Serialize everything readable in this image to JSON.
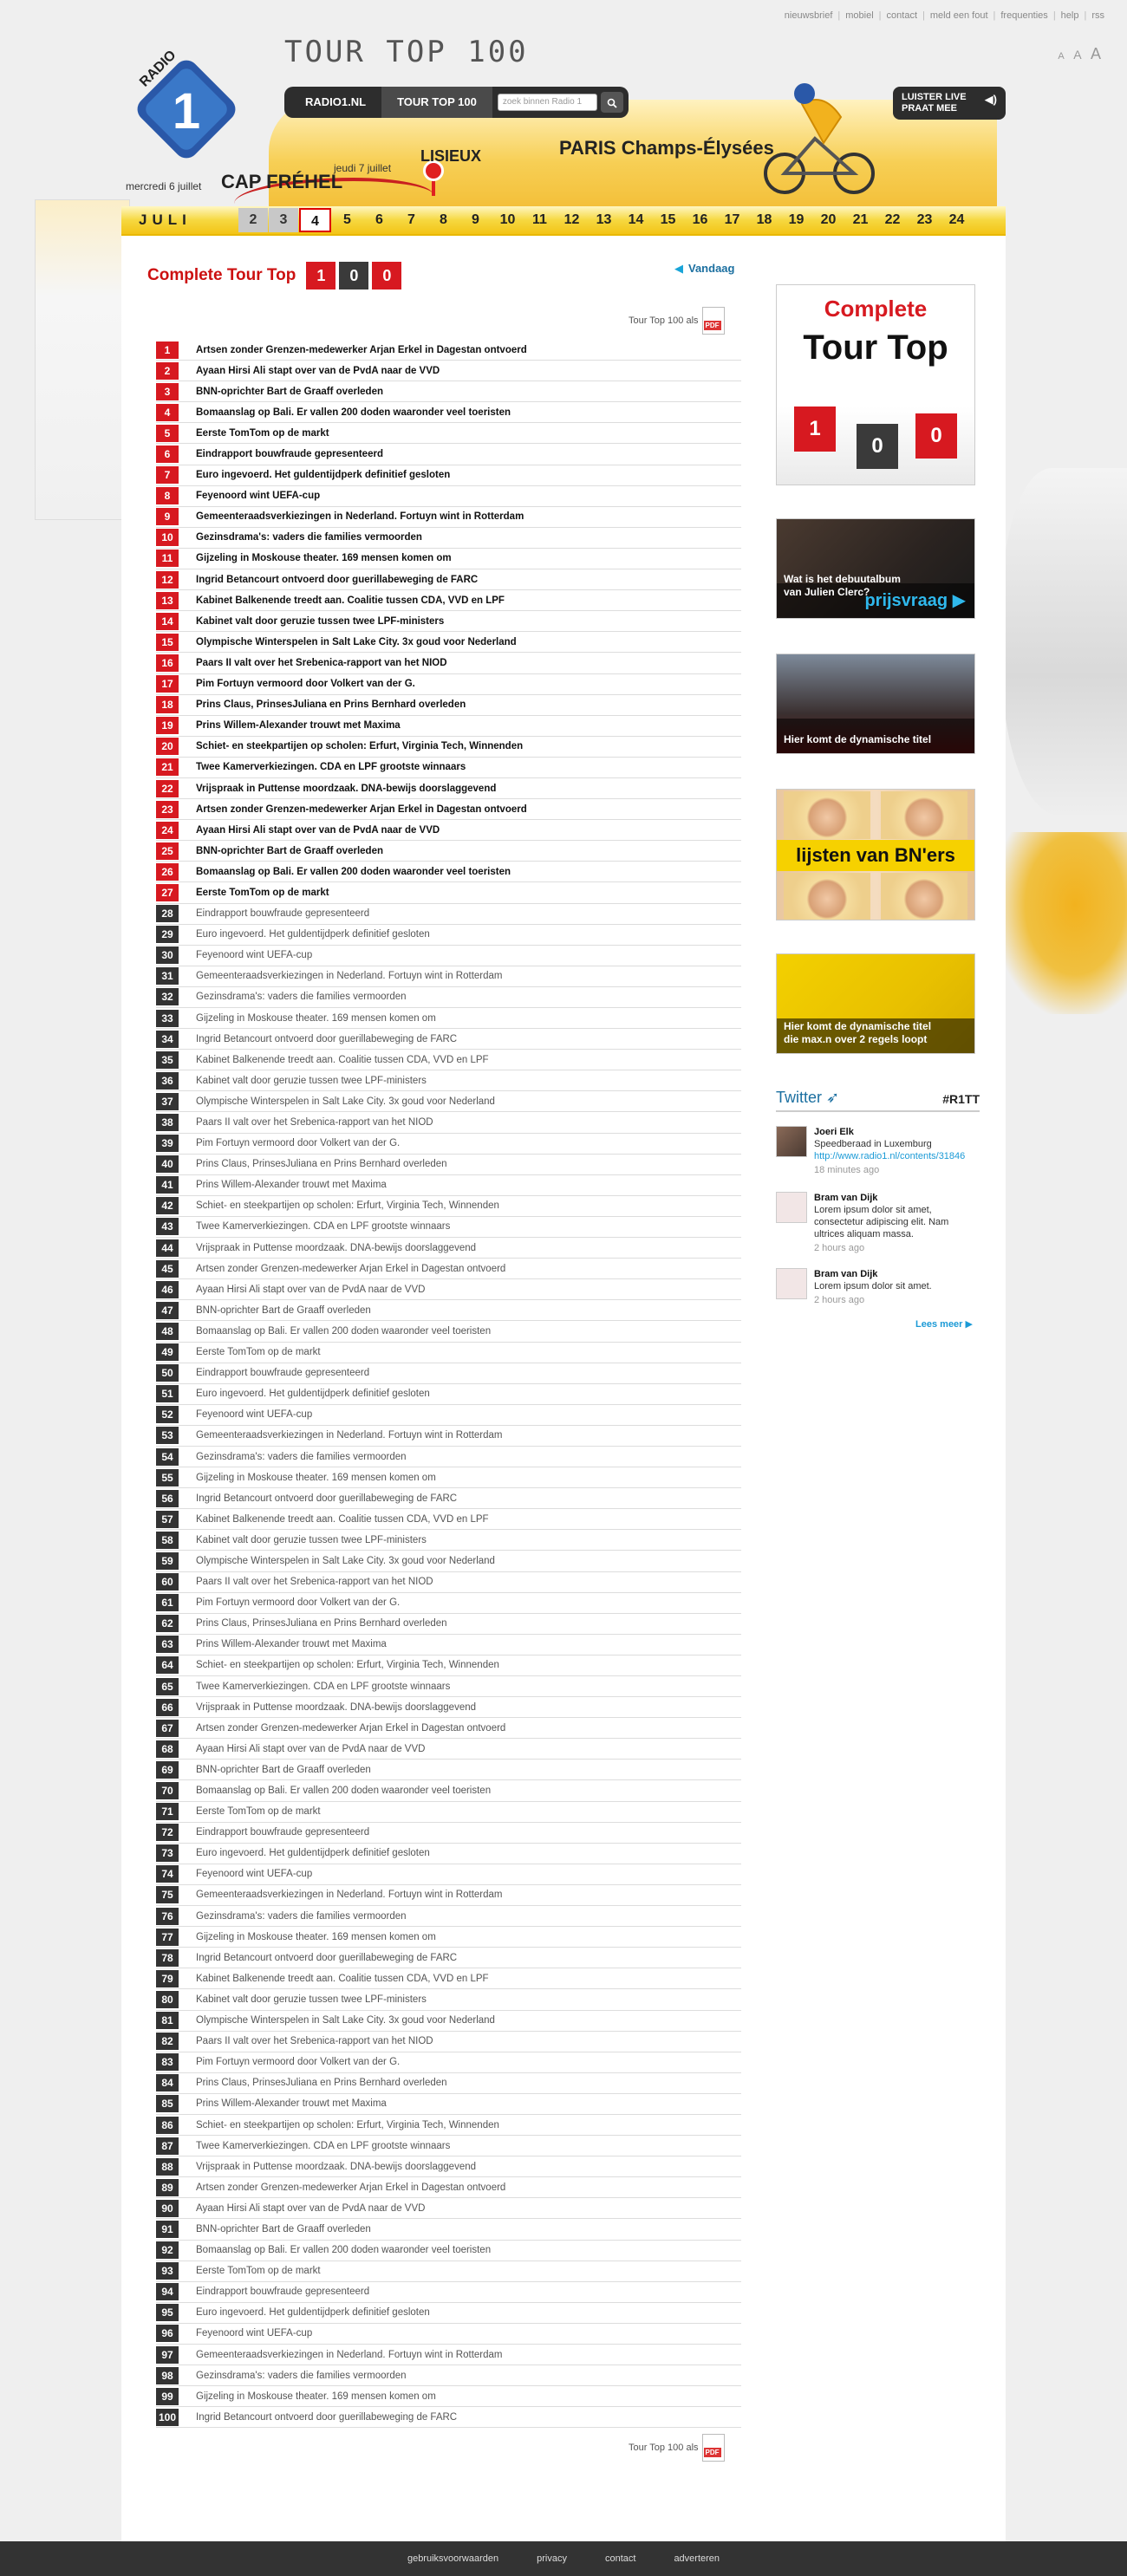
{
  "top_links": [
    "nieuwsbrief",
    "mobiel",
    "contact",
    "meld een fout",
    "frequenties",
    "help",
    "rss"
  ],
  "font_size_controls": [
    "A",
    "A",
    "A"
  ],
  "header": {
    "title": "TOUR TOP 100",
    "nav": [
      {
        "label": "RADIO1.NL",
        "active": false
      },
      {
        "label": "TOUR TOP 100",
        "active": true
      }
    ],
    "search_placeholder": "zoek binnen Radio 1",
    "search_icon": "magnifier-icon",
    "luister_line1": "LUISTER LIVE",
    "luister_line2": "PRAAT MEE",
    "stages": {
      "cap": "CAP FRÉHEL",
      "merc": "mercredi 6 juillet",
      "jeudi": "jeudi 7 juillet",
      "lisieux": "LISIEUX",
      "paris": "PARIS Champs-Élysées"
    },
    "logo_text": "RADIO"
  },
  "datebar": {
    "month": "JULI",
    "days": [
      "2",
      "3",
      "4",
      "5",
      "6",
      "7",
      "8",
      "9",
      "10",
      "11",
      "12",
      "13",
      "14",
      "15",
      "16",
      "17",
      "18",
      "19",
      "20",
      "21",
      "22",
      "23",
      "24"
    ],
    "today": "4",
    "past": [
      "2",
      "3"
    ]
  },
  "main": {
    "title": "Complete Tour Top",
    "title_boxes": [
      "1",
      "0",
      "0"
    ],
    "vandaag": "Vandaag",
    "pdf_label": "Tour Top 100 als",
    "rows": [
      "Artsen zonder Grenzen-medewerker Arjan Erkel in Dagestan ontvoerd",
      "Ayaan Hirsi Ali stapt over van de PvdA naar de VVD",
      "BNN-oprichter Bart de Graaff overleden",
      "Bomaanslag op Bali. Er vallen 200 doden waaronder veel toeristen",
      "Eerste TomTom op de markt",
      "Eindrapport bouwfraude gepresenteerd",
      "Euro ingevoerd. Het guldentijdperk definitief gesloten",
      "Feyenoord wint UEFA-cup",
      "Gemeenteraadsverkiezingen in Nederland. Fortuyn wint in Rotterdam",
      "Gezinsdrama's: vaders die families vermoorden",
      "Gijzeling in Moskouse theater. 169 mensen komen om",
      "Ingrid Betancourt ontvoerd door guerillabeweging de FARC",
      "Kabinet Balkenende treedt aan. Coalitie tussen CDA, VVD en LPF",
      "Kabinet valt door geruzie tussen twee LPF-ministers",
      "Olympische Winterspelen in Salt Lake City. 3x goud voor Nederland",
      "Paars II valt over het Srebenica-rapport van het NIOD",
      "Pim Fortuyn vermoord door Volkert van der G.",
      "Prins Claus, PrinsesJuliana en Prins Bernhard overleden",
      "Prins Willem-Alexander trouwt met Maxima",
      "Schiet- en steekpartijen op scholen: Erfurt, Virginia Tech, Winnenden",
      "Twee Kamerverkiezingen. CDA en LPF grootste winnaars",
      "Vrijspraak in Puttense moordzaak. DNA-bewijs doorslaggevend",
      "Artsen zonder Grenzen-medewerker Arjan Erkel in Dagestan ontvoerd",
      "Ayaan Hirsi Ali stapt over van de PvdA naar de VVD",
      "BNN-oprichter Bart de Graaff overleden",
      "Bomaanslag op Bali. Er vallen 200 doden waaronder veel toeristen",
      "Eerste TomTom op de markt",
      "Eindrapport bouwfraude gepresenteerd",
      "Euro ingevoerd. Het guldentijdperk definitief gesloten",
      "Feyenoord wint UEFA-cup",
      "Gemeenteraadsverkiezingen in Nederland. Fortuyn wint in Rotterdam",
      "Gezinsdrama's: vaders die families vermoorden",
      "Gijzeling in Moskouse theater. 169 mensen komen om",
      "Ingrid Betancourt ontvoerd door guerillabeweging de FARC",
      "Kabinet Balkenende treedt aan. Coalitie tussen CDA, VVD en LPF",
      "Kabinet valt door geruzie tussen twee LPF-ministers",
      "Olympische Winterspelen in Salt Lake City. 3x goud voor Nederland",
      "Paars II valt over het Srebenica-rapport van het NIOD",
      "Pim Fortuyn vermoord door Volkert van der G.",
      "Prins Claus, PrinsesJuliana en Prins Bernhard overleden",
      "Prins Willem-Alexander trouwt met Maxima",
      "Schiet- en steekpartijen op scholen: Erfurt, Virginia Tech, Winnenden",
      "Twee Kamerverkiezingen. CDA en LPF grootste winnaars",
      "Vrijspraak in Puttense moordzaak. DNA-bewijs doorslaggevend",
      "Artsen zonder Grenzen-medewerker Arjan Erkel in Dagestan ontvoerd",
      "Ayaan Hirsi Ali stapt over van de PvdA naar de VVD",
      "BNN-oprichter Bart de Graaff overleden",
      "Bomaanslag op Bali. Er vallen 200 doden waaronder veel toeristen",
      "Eerste TomTom op de markt",
      "Eindrapport bouwfraude gepresenteerd",
      "Euro ingevoerd. Het guldentijdperk definitief gesloten",
      "Feyenoord wint UEFA-cup",
      "Gemeenteraadsverkiezingen in Nederland. Fortuyn wint in Rotterdam",
      "Gezinsdrama's: vaders die families vermoorden",
      "Gijzeling in Moskouse theater. 169 mensen komen om",
      "Ingrid Betancourt ontvoerd door guerillabeweging de FARC",
      "Kabinet Balkenende treedt aan. Coalitie tussen CDA, VVD en LPF",
      "Kabinet valt door geruzie tussen twee LPF-ministers",
      "Olympische Winterspelen in Salt Lake City. 3x goud voor Nederland",
      "Paars II valt over het Srebenica-rapport van het NIOD",
      "Pim Fortuyn vermoord door Volkert van der G.",
      "Prins Claus, PrinsesJuliana en Prins Bernhard overleden",
      "Prins Willem-Alexander trouwt met Maxima",
      "Schiet- en steekpartijen op scholen: Erfurt, Virginia Tech, Winnenden",
      "Twee Kamerverkiezingen. CDA en LPF grootste winnaars",
      "Vrijspraak in Puttense moordzaak. DNA-bewijs doorslaggevend",
      "Artsen zonder Grenzen-medewerker Arjan Erkel in Dagestan ontvoerd",
      "Ayaan Hirsi Ali stapt over van de PvdA naar de VVD",
      "BNN-oprichter Bart de Graaff overleden",
      "Bomaanslag op Bali. Er vallen 200 doden waaronder veel toeristen",
      "Eerste TomTom op de markt",
      "Eindrapport bouwfraude gepresenteerd",
      "Euro ingevoerd. Het guldentijdperk definitief gesloten",
      "Feyenoord wint UEFA-cup",
      "Gemeenteraadsverkiezingen in Nederland. Fortuyn wint in Rotterdam",
      "Gezinsdrama's: vaders die families vermoorden",
      "Gijzeling in Moskouse theater. 169 mensen komen om",
      "Ingrid Betancourt ontvoerd door guerillabeweging de FARC",
      "Kabinet Balkenende treedt aan. Coalitie tussen CDA, VVD en LPF",
      "Kabinet valt door geruzie tussen twee LPF-ministers",
      "Olympische Winterspelen in Salt Lake City. 3x goud voor Nederland",
      "Paars II valt over het Srebenica-rapport van het NIOD",
      "Pim Fortuyn vermoord door Volkert van der G.",
      "Prins Claus, PrinsesJuliana en Prins Bernhard overleden",
      "Prins Willem-Alexander trouwt met Maxima",
      "Schiet- en steekpartijen op scholen: Erfurt, Virginia Tech, Winnenden",
      "Twee Kamerverkiezingen. CDA en LPF grootste winnaars",
      "Vrijspraak in Puttense moordzaak. DNA-bewijs doorslaggevend",
      "Artsen zonder Grenzen-medewerker Arjan Erkel in Dagestan ontvoerd",
      "Ayaan Hirsi Ali stapt over van de PvdA naar de VVD",
      "BNN-oprichter Bart de Graaff overleden",
      "Bomaanslag op Bali. Er vallen 200 doden waaronder veel toeristen",
      "Eerste TomTom op de markt",
      "Eindrapport bouwfraude gepresenteerd",
      "Euro ingevoerd. Het guldentijdperk definitief gesloten",
      "Feyenoord wint UEFA-cup",
      "Gemeenteraadsverkiezingen in Nederland. Fortuyn wint in Rotterdam",
      "Gezinsdrama's: vaders die families vermoorden",
      "Gijzeling in Moskouse theater. 169 mensen komen om",
      "Ingrid Betancourt ontvoerd door guerillabeweging de FARC"
    ],
    "hot_count": 27
  },
  "sidebar": {
    "promo1": {
      "line1": "Complete",
      "line2": "Tour Top",
      "boxes": [
        "1",
        "0",
        "0"
      ]
    },
    "promo2": {
      "caption1": "Wat is het debuutalbum",
      "caption2": "van Julien Clerc?",
      "cta": "prijsvraag"
    },
    "promo3": {
      "caption": "Hier komt de dynamische titel"
    },
    "promo4": {
      "caption": "lijsten van BN'ers"
    },
    "promo5": {
      "caption1": "Hier komt de dynamische titel",
      "caption2": "die max.n over 2 regels loopt"
    },
    "twitter": {
      "title": "Twitter",
      "hashtag": "#R1TT",
      "tweets": [
        {
          "user": "Joeri Elk",
          "text": "Speedberaad in Luxemburg",
          "link": "http://www.radio1.nl/contents/31846",
          "time": "18 minutes ago",
          "photo": true
        },
        {
          "user": "Bram van Dijk",
          "text": "Lorem ipsum dolor sit amet, consectetur adipiscing elit. Nam ultrices aliquam massa.",
          "link": "",
          "time": "2 hours ago",
          "photo": false
        },
        {
          "user": "Bram van Dijk",
          "text": "Lorem ipsum dolor sit amet.",
          "link": "",
          "time": "2 hours ago",
          "photo": false
        }
      ],
      "more": "Lees meer"
    }
  },
  "footer": [
    "gebruiksvoorwaarden",
    "privacy",
    "contact",
    "adverteren"
  ],
  "colors": {
    "accent_red": "#d71920",
    "dark": "#2d2d2d",
    "yellow": "#f3c416",
    "link_blue": "#1b9ad6"
  }
}
